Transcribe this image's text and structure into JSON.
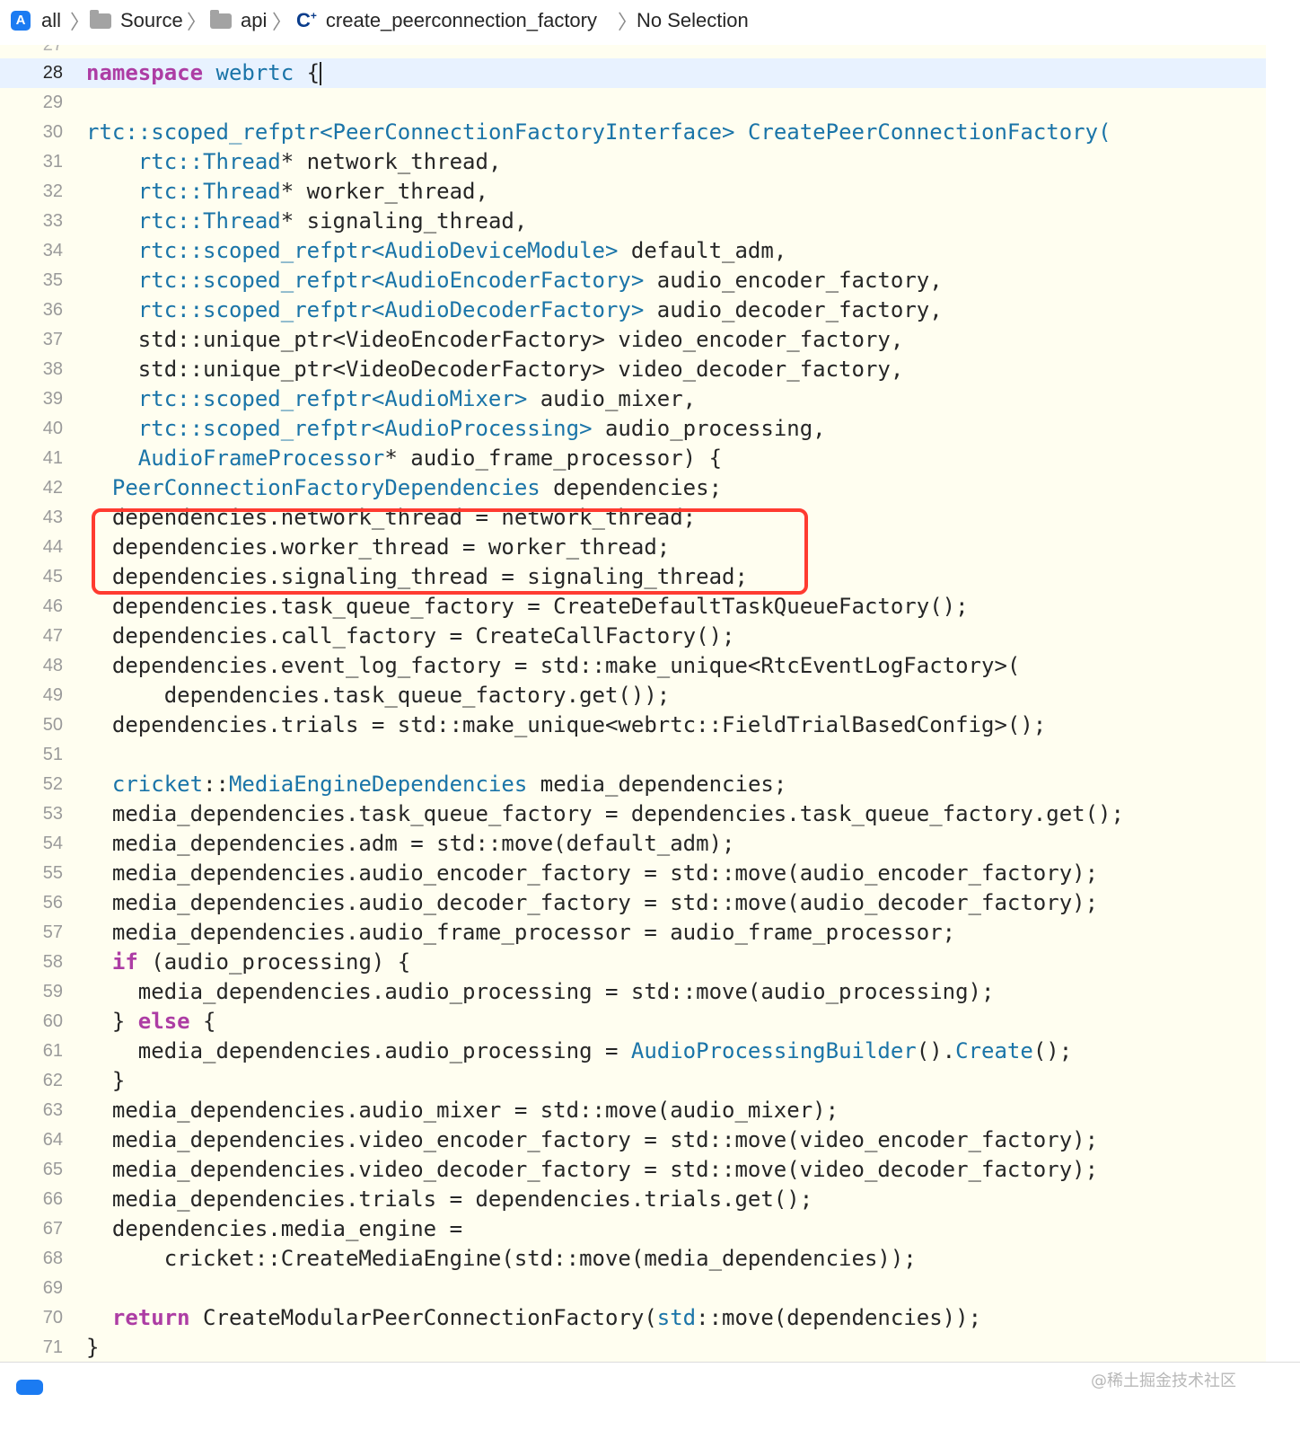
{
  "breadcrumb": {
    "items": [
      "all",
      "Source",
      "api",
      "create_peerconnection_factory",
      "No Selection"
    ],
    "cpp_badge": "C",
    "cpp_badge_plus": "+"
  },
  "editor": {
    "partial_top_line": "27",
    "current_line": 28,
    "lines": [
      {
        "n": "28",
        "tokens": [
          {
            "t": "namespace",
            "c": "kw"
          },
          {
            "t": " "
          },
          {
            "t": "webrtc",
            "c": "ty"
          },
          {
            "t": " {"
          }
        ]
      },
      {
        "n": "29",
        "tokens": []
      },
      {
        "n": "30",
        "tokens": [
          {
            "t": "rtc::scoped_refptr<",
            "c": "ty"
          },
          {
            "t": "PeerConnectionFactoryInterface",
            "c": "ty"
          },
          {
            "t": "> ",
            "c": "ty"
          },
          {
            "t": "CreatePeerConnectionFactory",
            "c": "fn"
          },
          {
            "t": "(",
            "c": "ty"
          }
        ]
      },
      {
        "n": "31",
        "tokens": [
          {
            "t": "    "
          },
          {
            "t": "rtc::Thread",
            "c": "ty"
          },
          {
            "t": "* network_thread,"
          }
        ]
      },
      {
        "n": "32",
        "tokens": [
          {
            "t": "    "
          },
          {
            "t": "rtc::Thread",
            "c": "ty"
          },
          {
            "t": "* worker_thread,"
          }
        ]
      },
      {
        "n": "33",
        "tokens": [
          {
            "t": "    "
          },
          {
            "t": "rtc::Thread",
            "c": "ty"
          },
          {
            "t": "* signaling_thread,"
          }
        ]
      },
      {
        "n": "34",
        "tokens": [
          {
            "t": "    "
          },
          {
            "t": "rtc::scoped_refptr<AudioDeviceModule>",
            "c": "ty"
          },
          {
            "t": " default_adm,"
          }
        ]
      },
      {
        "n": "35",
        "tokens": [
          {
            "t": "    "
          },
          {
            "t": "rtc::scoped_refptr<AudioEncoderFactory>",
            "c": "ty"
          },
          {
            "t": " audio_encoder_factory,"
          }
        ]
      },
      {
        "n": "36",
        "tokens": [
          {
            "t": "    "
          },
          {
            "t": "rtc::scoped_refptr<AudioDecoderFactory>",
            "c": "ty"
          },
          {
            "t": " audio_decoder_factory,"
          }
        ]
      },
      {
        "n": "37",
        "tokens": [
          {
            "t": "    std::unique_ptr<VideoEncoderFactory> video_encoder_factory,"
          }
        ]
      },
      {
        "n": "38",
        "tokens": [
          {
            "t": "    std::unique_ptr<VideoDecoderFactory> video_decoder_factory,"
          }
        ]
      },
      {
        "n": "39",
        "tokens": [
          {
            "t": "    "
          },
          {
            "t": "rtc::scoped_refptr<AudioMixer>",
            "c": "ty"
          },
          {
            "t": " audio_mixer,"
          }
        ]
      },
      {
        "n": "40",
        "tokens": [
          {
            "t": "    "
          },
          {
            "t": "rtc::scoped_refptr<AudioProcessing>",
            "c": "ty"
          },
          {
            "t": " audio_processing,"
          }
        ]
      },
      {
        "n": "41",
        "tokens": [
          {
            "t": "    "
          },
          {
            "t": "AudioFrameProcessor",
            "c": "ty"
          },
          {
            "t": "* audio_frame_processor) {"
          }
        ]
      },
      {
        "n": "42",
        "tokens": [
          {
            "t": "  "
          },
          {
            "t": "PeerConnectionFactoryDependencies",
            "c": "ty"
          },
          {
            "t": " dependencies;"
          }
        ]
      },
      {
        "n": "43",
        "tokens": [
          {
            "t": "  dependencies.network_thread = network_thread;"
          }
        ]
      },
      {
        "n": "44",
        "tokens": [
          {
            "t": "  dependencies.worker_thread = worker_thread;"
          }
        ]
      },
      {
        "n": "45",
        "tokens": [
          {
            "t": "  dependencies.signaling_thread = signaling_thread;"
          }
        ]
      },
      {
        "n": "46",
        "tokens": [
          {
            "t": "  dependencies.task_queue_factory = CreateDefaultTaskQueueFactory();"
          }
        ]
      },
      {
        "n": "47",
        "tokens": [
          {
            "t": "  dependencies.call_factory = CreateCallFactory();"
          }
        ]
      },
      {
        "n": "48",
        "tokens": [
          {
            "t": "  dependencies.event_log_factory = std::make_unique<RtcEventLogFactory>("
          }
        ]
      },
      {
        "n": "49",
        "tokens": [
          {
            "t": "      dependencies.task_queue_factory.get());"
          }
        ]
      },
      {
        "n": "50",
        "tokens": [
          {
            "t": "  dependencies.trials = std::make_unique<webrtc::FieldTrialBasedConfig>();"
          }
        ]
      },
      {
        "n": "51",
        "tokens": []
      },
      {
        "n": "52",
        "tokens": [
          {
            "t": "  "
          },
          {
            "t": "cricket",
            "c": "ty"
          },
          {
            "t": "::"
          },
          {
            "t": "MediaEngineDependencies",
            "c": "ty"
          },
          {
            "t": " media_dependencies;"
          }
        ]
      },
      {
        "n": "53",
        "tokens": [
          {
            "t": "  media_dependencies.task_queue_factory = dependencies.task_queue_factory.get();"
          }
        ]
      },
      {
        "n": "54",
        "tokens": [
          {
            "t": "  media_dependencies.adm = std::move(default_adm);"
          }
        ]
      },
      {
        "n": "55",
        "tokens": [
          {
            "t": "  media_dependencies.audio_encoder_factory = std::move(audio_encoder_factory);"
          }
        ]
      },
      {
        "n": "56",
        "tokens": [
          {
            "t": "  media_dependencies.audio_decoder_factory = std::move(audio_decoder_factory);"
          }
        ]
      },
      {
        "n": "57",
        "tokens": [
          {
            "t": "  media_dependencies.audio_frame_processor = audio_frame_processor;"
          }
        ]
      },
      {
        "n": "58",
        "tokens": [
          {
            "t": "  "
          },
          {
            "t": "if",
            "c": "kw"
          },
          {
            "t": " (audio_processing) {"
          }
        ]
      },
      {
        "n": "59",
        "tokens": [
          {
            "t": "    media_dependencies.audio_processing = std::move(audio_processing);"
          }
        ]
      },
      {
        "n": "60",
        "tokens": [
          {
            "t": "  } "
          },
          {
            "t": "else",
            "c": "kw"
          },
          {
            "t": " {"
          }
        ]
      },
      {
        "n": "61",
        "tokens": [
          {
            "t": "    media_dependencies.audio_processing = "
          },
          {
            "t": "AudioProcessingBuilder",
            "c": "ty"
          },
          {
            "t": "()."
          },
          {
            "t": "Create",
            "c": "fn"
          },
          {
            "t": "();"
          }
        ]
      },
      {
        "n": "62",
        "tokens": [
          {
            "t": "  }"
          }
        ]
      },
      {
        "n": "63",
        "tokens": [
          {
            "t": "  media_dependencies.audio_mixer = std::move(audio_mixer);"
          }
        ]
      },
      {
        "n": "64",
        "tokens": [
          {
            "t": "  media_dependencies.video_encoder_factory = std::move(video_encoder_factory);"
          }
        ]
      },
      {
        "n": "65",
        "tokens": [
          {
            "t": "  media_dependencies.video_decoder_factory = std::move(video_decoder_factory);"
          }
        ]
      },
      {
        "n": "66",
        "tokens": [
          {
            "t": "  media_dependencies.trials = dependencies.trials.get();"
          }
        ]
      },
      {
        "n": "67",
        "tokens": [
          {
            "t": "  dependencies.media_engine ="
          }
        ]
      },
      {
        "n": "68",
        "tokens": [
          {
            "t": "      cricket::CreateMediaEngine(std::move(media_dependencies));"
          }
        ]
      },
      {
        "n": "69",
        "tokens": []
      },
      {
        "n": "70",
        "tokens": [
          {
            "t": "  "
          },
          {
            "t": "return",
            "c": "kw"
          },
          {
            "t": " CreateModularPeerConnectionFactory("
          },
          {
            "t": "std",
            "c": "ty"
          },
          {
            "t": "::move(dependencies));"
          }
        ]
      },
      {
        "n": "71",
        "tokens": [
          {
            "t": "}"
          }
        ]
      }
    ]
  },
  "watermark": "@稀土掘金技术社区"
}
